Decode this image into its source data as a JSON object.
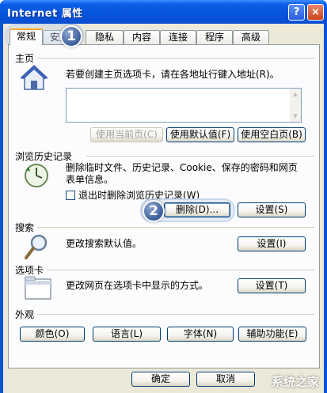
{
  "window": {
    "title": "Internet 属性",
    "help_label": "?",
    "close_label": "×"
  },
  "tabs": [
    {
      "label": "常规"
    },
    {
      "label": "安全"
    },
    {
      "label": "隐私"
    },
    {
      "label": "内容"
    },
    {
      "label": "连接"
    },
    {
      "label": "程序"
    },
    {
      "label": "高级"
    }
  ],
  "callouts": {
    "step1": "1",
    "step2": "2"
  },
  "homepage": {
    "title": "主页",
    "description": "若要创建主页选项卡，请在各地址行键入地址(R)。",
    "address_value": "",
    "use_current_label": "使用当前页(C)",
    "use_default_label": "使用默认值(F)",
    "use_blank_label": "使用空白页(B)"
  },
  "history": {
    "title": "浏览历史记录",
    "description_line1": "删除临时文件、历史记录、Cookie、保存的密码和网页",
    "description_line2": "表单信息。",
    "checkbox_label": "退出时删除浏览历史记录(W)",
    "delete_label": "删除(D)...",
    "settings_label": "设置(S)"
  },
  "search": {
    "title": "搜索",
    "description": "更改搜索默认值。",
    "settings_label": "设置(I)"
  },
  "tabsgroup": {
    "title": "选项卡",
    "description": "更改网页在选项卡中显示的方式。",
    "settings_label": "设置(T)"
  },
  "appearance": {
    "title": "外观",
    "colors_label": "颜色(O)",
    "languages_label": "语言(L)",
    "fonts_label": "字体(N)",
    "accessibility_label": "辅助功能(E)"
  },
  "footer": {
    "ok_label": "确定",
    "cancel_label": "取消"
  },
  "watermark": "系统之家"
}
